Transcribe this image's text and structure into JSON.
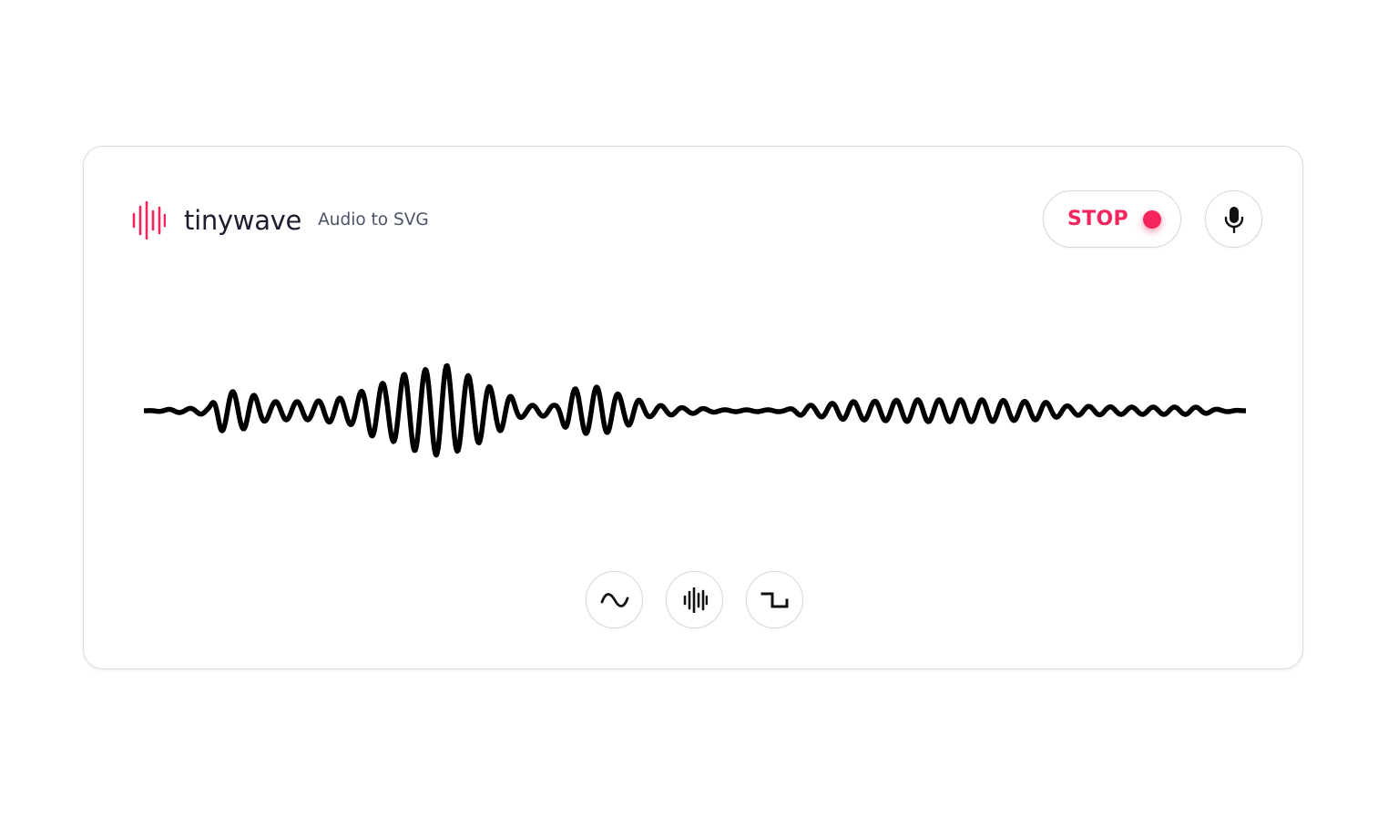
{
  "app": {
    "name": "tinywave",
    "tagline": "Audio to SVG",
    "accent_color": "#f2255d"
  },
  "header": {
    "logo_icon": "waveform-bars-icon",
    "stop_button": {
      "label": "STOP",
      "indicator": "recording-dot",
      "indicator_color": "#f5245a"
    },
    "mic_button": {
      "icon": "microphone-icon"
    }
  },
  "waveform": {
    "style": "sine",
    "stroke_color": "#000000",
    "state": "recording"
  },
  "mode_buttons": [
    {
      "id": "sine",
      "icon": "sine-wave-icon"
    },
    {
      "id": "bars",
      "icon": "waveform-bars-icon"
    },
    {
      "id": "square",
      "icon": "square-wave-icon"
    }
  ]
}
